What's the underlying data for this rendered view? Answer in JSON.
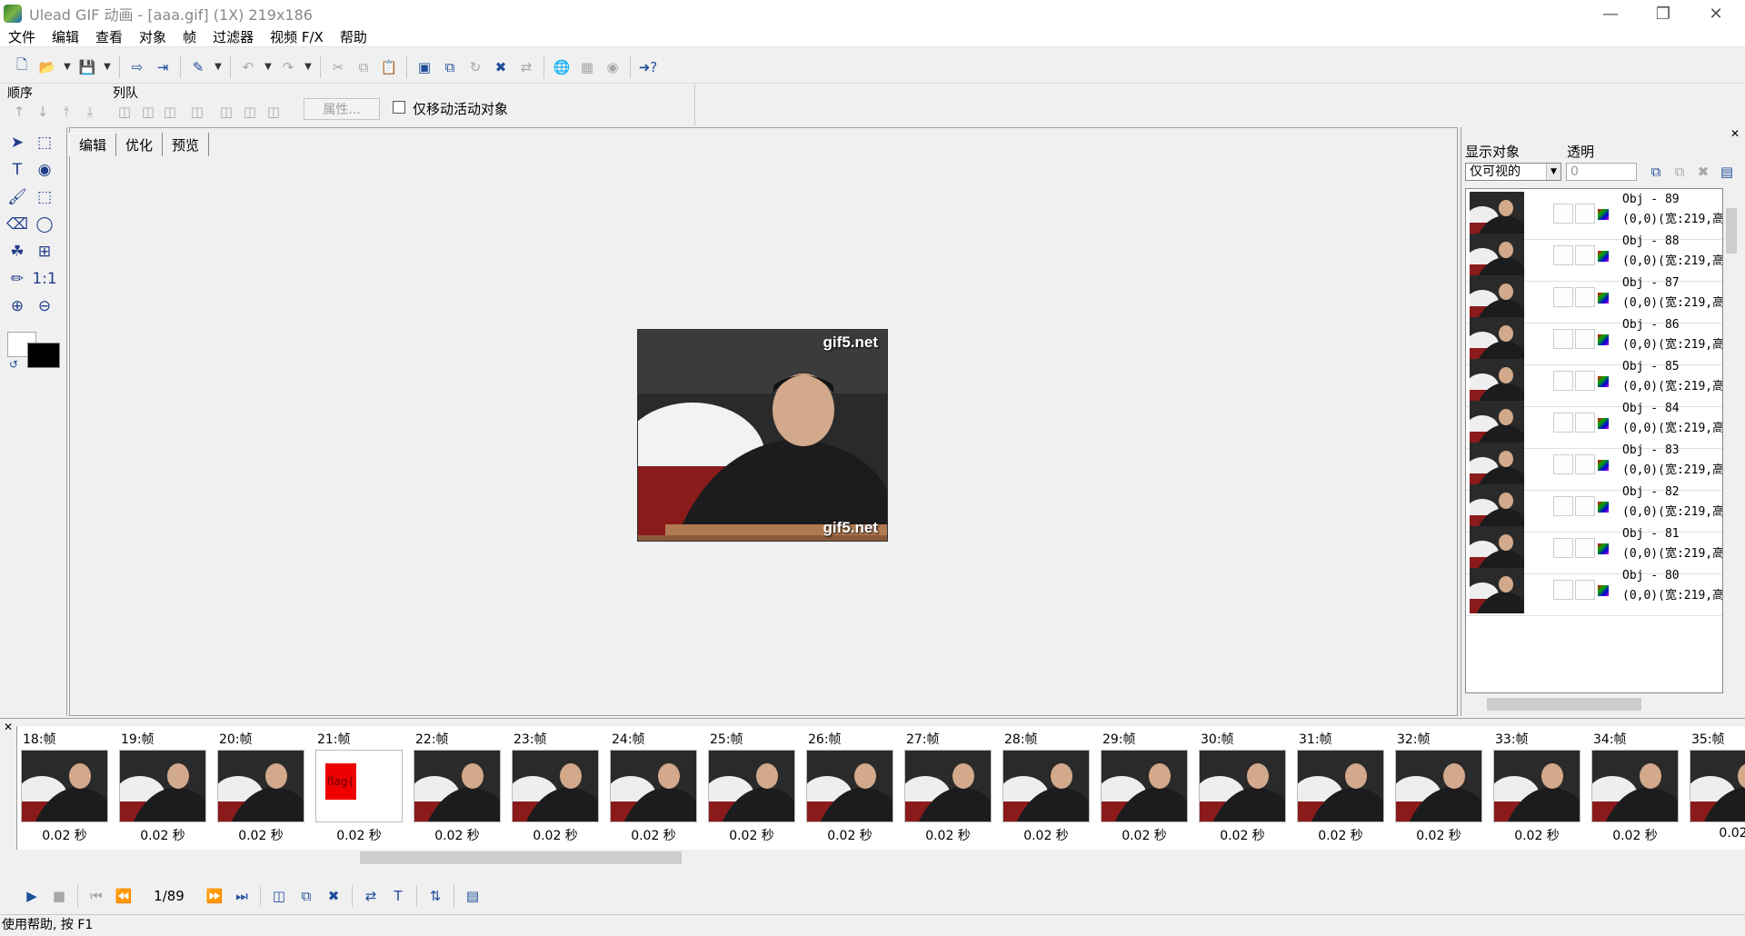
{
  "window": {
    "title": "Ulead GIF 动画 - [aaa.gif] (1X) 219x186"
  },
  "menu": [
    "文件",
    "编辑",
    "查看",
    "对象",
    "帧",
    "过滤器",
    "视频 F/X",
    "帮助"
  ],
  "toolbar2": {
    "order_label": "顺序",
    "queue_label": "列队",
    "properties_label": "属性...",
    "move_active_only_label": "仅移动活动对象"
  },
  "editor": {
    "tabs": [
      "编辑",
      "优化",
      "预览"
    ],
    "watermark": "gif5.net"
  },
  "object_panel": {
    "show_objects_label": "显示对象",
    "transparency_label": "透明",
    "show_mode": "仅可视的",
    "transparency_value": "0",
    "objects": [
      {
        "name": "Obj - 89",
        "coords": "(0,0)(宽:219,高"
      },
      {
        "name": "Obj - 88",
        "coords": "(0,0)(宽:219,高"
      },
      {
        "name": "Obj - 87",
        "coords": "(0,0)(宽:219,高"
      },
      {
        "name": "Obj - 86",
        "coords": "(0,0)(宽:219,高"
      },
      {
        "name": "Obj - 85",
        "coords": "(0,0)(宽:219,高"
      },
      {
        "name": "Obj - 84",
        "coords": "(0,0)(宽:219,高"
      },
      {
        "name": "Obj - 83",
        "coords": "(0,0)(宽:219,高"
      },
      {
        "name": "Obj - 82",
        "coords": "(0,0)(宽:219,高"
      },
      {
        "name": "Obj - 81",
        "coords": "(0,0)(宽:219,高"
      },
      {
        "name": "Obj - 80",
        "coords": "(0,0)(宽:219,高"
      }
    ]
  },
  "frames": {
    "items": [
      {
        "label": "18:帧",
        "delay": "0.02 秒",
        "type": "photo"
      },
      {
        "label": "19:帧",
        "delay": "0.02 秒",
        "type": "photo"
      },
      {
        "label": "20:帧",
        "delay": "0.02 秒",
        "type": "photo"
      },
      {
        "label": "21:帧",
        "delay": "0.02 秒",
        "type": "flag",
        "flag_text": "flag{"
      },
      {
        "label": "22:帧",
        "delay": "0.02 秒",
        "type": "photo"
      },
      {
        "label": "23:帧",
        "delay": "0.02 秒",
        "type": "photo"
      },
      {
        "label": "24:帧",
        "delay": "0.02 秒",
        "type": "photo"
      },
      {
        "label": "25:帧",
        "delay": "0.02 秒",
        "type": "photo"
      },
      {
        "label": "26:帧",
        "delay": "0.02 秒",
        "type": "photo"
      },
      {
        "label": "27:帧",
        "delay": "0.02 秒",
        "type": "photo"
      },
      {
        "label": "28:帧",
        "delay": "0.02 秒",
        "type": "photo"
      },
      {
        "label": "29:帧",
        "delay": "0.02 秒",
        "type": "photo"
      },
      {
        "label": "30:帧",
        "delay": "0.02 秒",
        "type": "photo"
      },
      {
        "label": "31:帧",
        "delay": "0.02 秒",
        "type": "photo"
      },
      {
        "label": "32:帧",
        "delay": "0.02 秒",
        "type": "photo"
      },
      {
        "label": "33:帧",
        "delay": "0.02 秒",
        "type": "photo"
      },
      {
        "label": "34:帧",
        "delay": "0.02 秒",
        "type": "photo"
      },
      {
        "label": "35:帧",
        "delay": "0.02",
        "type": "photo"
      }
    ]
  },
  "playback": {
    "counter": "1/89"
  },
  "status": {
    "text": "使用帮助, 按 F1"
  }
}
